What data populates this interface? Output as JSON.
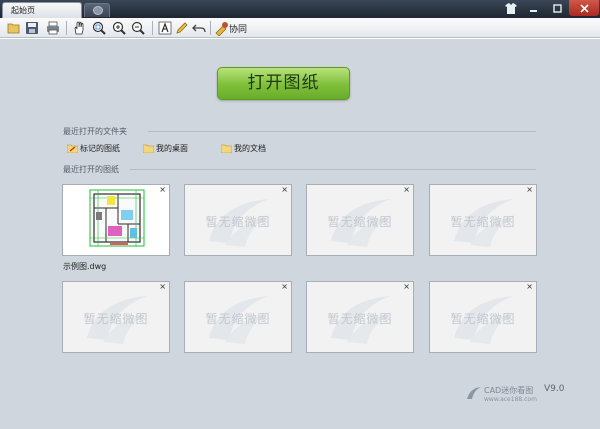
{
  "tabs": {
    "start_label": "起始页"
  },
  "toolbar": {
    "buttons": [
      "open-icon",
      "save-icon",
      "print-icon",
      "pan-icon",
      "zoom-window-icon",
      "zoom-in-icon",
      "zoom-out-icon",
      "text-icon",
      "pencil-icon",
      "undo-icon",
      "collab-icon"
    ],
    "collab_label": "协同"
  },
  "main": {
    "open_button_label": "打开图纸",
    "recent_folders_title": "最近打开的文件夹",
    "folders": [
      {
        "label": "标记的图纸",
        "icon": "marked-folder-icon"
      },
      {
        "label": "我的桌面",
        "icon": "folder-icon"
      },
      {
        "label": "我的文档",
        "icon": "folder-icon"
      }
    ],
    "recent_drawings_title": "最近打开的图纸",
    "placeholder_text": "暂无缩微图",
    "close_glyph": "×",
    "first_drawing_name": "示例图.dwg"
  },
  "brand": {
    "name": "CAD迷你看图",
    "version": "V9.0",
    "url": "www.ace188.com"
  },
  "colors": {
    "accent_green": "#7fbf3a",
    "background": "#d0d6dd",
    "titlebar": "#1e2630"
  }
}
